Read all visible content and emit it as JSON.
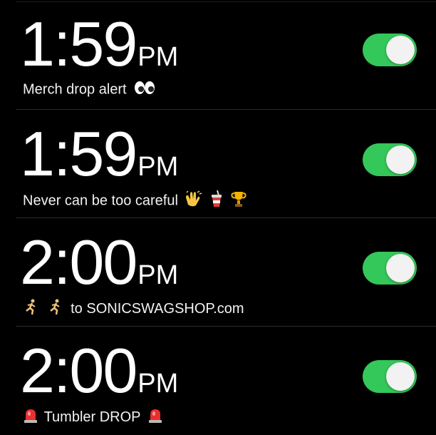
{
  "alarms": [
    {
      "time": "1:59",
      "ampm": "PM",
      "label": "Merch drop alert",
      "label_emoji_after": [
        "eyes-icon"
      ],
      "enabled": true
    },
    {
      "time": "1:59",
      "ampm": "PM",
      "label": "Never can be too careful",
      "label_emoji_after": [
        "clapping-hands-icon",
        "cup-with-straw-icon",
        "trophy-icon"
      ],
      "enabled": true
    },
    {
      "time": "2:00",
      "ampm": "PM",
      "label": "to SONICSWAGSHOP.com",
      "label_emoji_before": [
        "runner-icon",
        "runner-icon"
      ],
      "enabled": true
    },
    {
      "time": "2:00",
      "ampm": "PM",
      "label": "Tumbler DROP",
      "label_emoji_before": [
        "siren-icon"
      ],
      "label_emoji_after": [
        "siren-icon"
      ],
      "enabled": true
    }
  ],
  "colors": {
    "background": "#000000",
    "toggle_on": "#34c759",
    "toggle_knob": "#f2f2f2",
    "text": "#ffffff"
  }
}
